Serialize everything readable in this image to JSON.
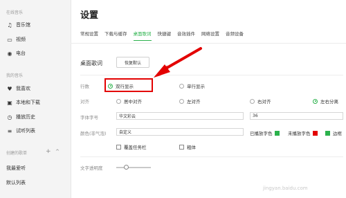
{
  "sidebar": {
    "sections": [
      "在线音乐",
      "我的音乐",
      "创建的歌单"
    ],
    "online_items": [
      {
        "label": "音乐馆",
        "icon": "note-icon"
      },
      {
        "label": "视频",
        "icon": "video-icon"
      },
      {
        "label": "电台",
        "icon": "radio-icon"
      }
    ],
    "my_items": [
      {
        "label": "我喜欢",
        "icon": "heart-icon"
      },
      {
        "label": "本地和下载",
        "icon": "monitor-icon"
      },
      {
        "label": "播放历史",
        "icon": "history-icon"
      },
      {
        "label": "试听列表",
        "icon": "list-icon"
      }
    ],
    "created_items": [
      "我最爱听",
      "默认列表"
    ]
  },
  "title": "设置",
  "tabs": [
    "常规设置",
    "下载与缓存",
    "桌面歌词",
    "快捷键",
    "音效插件",
    "网络设置",
    "音频设备"
  ],
  "active_tab": "桌面歌词",
  "section": {
    "title": "桌面歌词",
    "reset_button": "恢复默认"
  },
  "rows": {
    "lines_label": "行数",
    "lines_options": [
      "双行显示",
      "单行显示"
    ],
    "align_label": "对齐",
    "align_options": [
      "居中对齐",
      "左对齐",
      "右对齐",
      "左右分离"
    ],
    "font_label": "字体字号",
    "font_value": "华文彩云",
    "size_value": "36",
    "color_label": "颜色(非气泡)",
    "color_value": "自定义",
    "played_label": "已播放字色",
    "unplayed_label": "未播放字色",
    "border_label": "边框",
    "cover_taskbar": "覆盖任务栏",
    "bold": "粗体",
    "opacity_label": "文字透明度"
  },
  "colors": {
    "accent": "#2bb24c",
    "played": "#2bb24c",
    "unplayed": "#e30000",
    "annotation": "#e30000"
  },
  "watermark": "jingyan.baidu.com"
}
